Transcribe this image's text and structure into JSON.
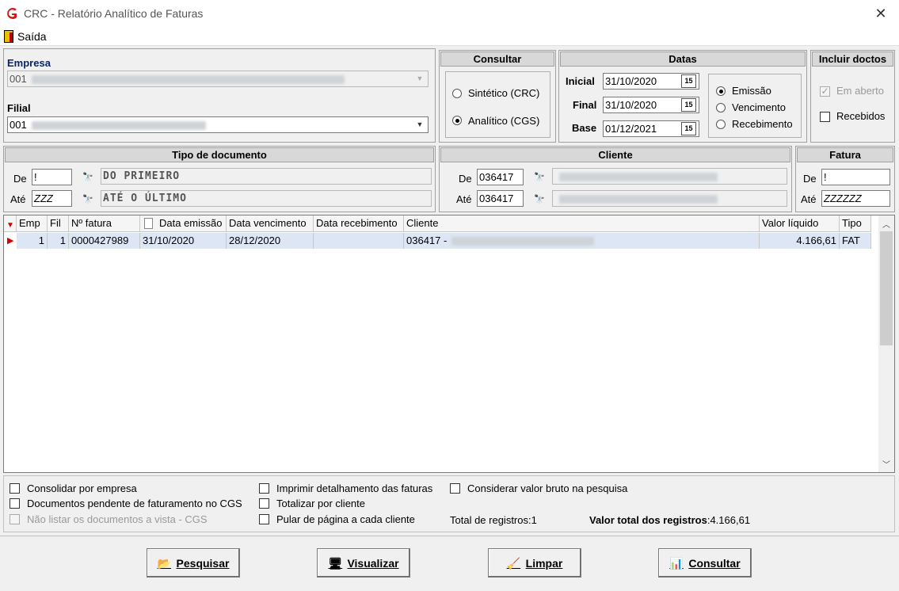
{
  "window": {
    "title": "CRC - Relatório Analítico de Faturas",
    "close": "✕"
  },
  "menu": {
    "saida": "Saída"
  },
  "empresa": {
    "label": "Empresa",
    "code": "001"
  },
  "filial": {
    "label": "Filial",
    "code": "001"
  },
  "consultar": {
    "title": "Consultar",
    "sintetico": "Sintético (CRC)",
    "analitico": "Analítico (CGS)",
    "selected": "analitico"
  },
  "datas": {
    "title": "Datas",
    "inicial_label": "Inicial",
    "inicial": "31/10/2020",
    "final_label": "Final",
    "final": "31/10/2020",
    "base_label": "Base",
    "base": "01/12/2021",
    "cal": "15",
    "emissao": "Emissão",
    "vencimento": "Vencimento",
    "recebimento": "Recebimento",
    "selected": "emissao"
  },
  "incluir": {
    "title": "Incluir doctos",
    "em_aberto": "Em aberto",
    "recebidos": "Recebidos"
  },
  "tipo_doc": {
    "title": "Tipo de documento",
    "de_label": "De",
    "de": "!",
    "de_desc": "DO PRIMEIRO",
    "ate_label": "Até",
    "ate": "ZZZ",
    "ate_desc": "ATÉ O ÚLTIMO"
  },
  "cliente": {
    "title": "Cliente",
    "de_label": "De",
    "de": "036417",
    "ate_label": "Até",
    "ate": "036417"
  },
  "fatura": {
    "title": "Fatura",
    "de_label": "De",
    "de": "!",
    "ate_label": "Até",
    "ate": "ZZZZZZ"
  },
  "grid": {
    "columns": [
      "Emp",
      "Fil",
      "Nº fatura",
      "Data emissão",
      "Data vencimento",
      "Data recebimento",
      "Cliente",
      "Valor líquido",
      "Tipo"
    ],
    "rows": [
      {
        "emp": "1",
        "fil": "1",
        "fatura": "0000427989",
        "emissao": "31/10/2020",
        "vencimento": "28/12/2020",
        "recebimento": "",
        "cliente": "036417 -",
        "valor": "4.166,61",
        "tipo": "FAT"
      }
    ]
  },
  "options": {
    "consolidar": "Consolidar por empresa",
    "pendentes": "Documentos pendente de faturamento no CGS",
    "nao_listar": "Não listar os documentos a vista - CGS",
    "imprimir": "Imprimir detalhamento das faturas",
    "totalizar": "Totalizar por cliente",
    "pular": "Pular de página a cada cliente",
    "valor_bruto": "Considerar valor bruto na pesquisa",
    "total_registros": "Total de registros:1",
    "valor_total_label": "Valor total dos registros",
    "valor_total": ":4.166,61"
  },
  "buttons": {
    "pesquisar": "Pesquisar",
    "visualizar": "Visualizar",
    "limpar": "Limpar",
    "consultar": "Consultar"
  }
}
